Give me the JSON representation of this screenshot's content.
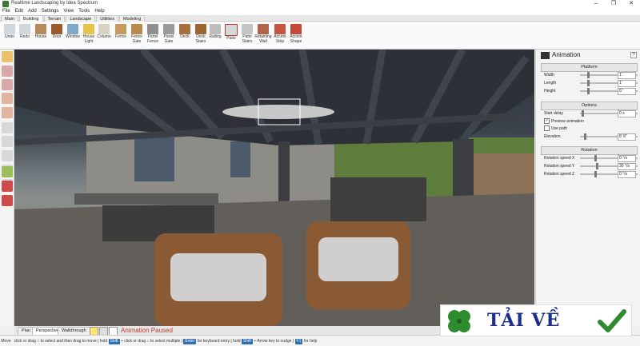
{
  "window": {
    "title": "Realtime Landscaping by Idea Spectrum"
  },
  "menu": [
    "File",
    "Edit",
    "Add",
    "Settings",
    "View",
    "Tools",
    "Help"
  ],
  "ribbon_tabs": [
    "Main",
    "Building",
    "Terrain",
    "Landscape",
    "Utilities",
    "Modeling"
  ],
  "active_ribbon_tab": "Building",
  "tools": [
    {
      "l1": "Undo",
      "l2": ""
    },
    {
      "l1": "Redo",
      "l2": ""
    },
    {
      "l1": "House",
      "l2": ""
    },
    {
      "l1": "Door",
      "l2": ""
    },
    {
      "l1": "Window",
      "l2": ""
    },
    {
      "l1": "House",
      "l2": "Light"
    },
    {
      "l1": "Column",
      "l2": ""
    },
    {
      "l1": "Fence",
      "l2": ""
    },
    {
      "l1": "Fence",
      "l2": "Gate"
    },
    {
      "l1": "Panel",
      "l2": "Fence"
    },
    {
      "l1": "Panel",
      "l2": "Gate"
    },
    {
      "l1": "Deck",
      "l2": ""
    },
    {
      "l1": "Deck",
      "l2": "Stairs"
    },
    {
      "l1": "Railing",
      "l2": ""
    },
    {
      "l1": "Patio",
      "l2": ""
    },
    {
      "l1": "Patio",
      "l2": "Stairs"
    },
    {
      "l1": "Retaining",
      "l2": "Wall"
    },
    {
      "l1": "Accent",
      "l2": "Strip"
    },
    {
      "l1": "Accent",
      "l2": "Shape"
    }
  ],
  "panel": {
    "title": "Animation",
    "help": "?",
    "platform": {
      "header": "Platform",
      "rows": [
        {
          "label": "Width",
          "value": "1'",
          "level": 0.2
        },
        {
          "label": "Length",
          "value": "1'",
          "level": 0.2
        },
        {
          "label": "Height",
          "value": "6\"",
          "level": 0.2
        }
      ]
    },
    "options": {
      "header": "Options",
      "start_delay": {
        "label": "Start delay",
        "value": "0 s",
        "level": 0.05
      },
      "preview": {
        "label": "Preview animation",
        "checked": true
      },
      "use_path": {
        "label": "Use path",
        "checked": false
      },
      "elevation": {
        "label": "Elevation",
        "value": "8' 8\"",
        "level": 0.12
      }
    },
    "rotation": {
      "header": "Rotation",
      "rows": [
        {
          "label": "Rotation speed X",
          "value": "0 °/s",
          "level": 0.4
        },
        {
          "label": "Rotation speed Y",
          "value": "30 °/s",
          "level": 0.45
        },
        {
          "label": "Rotation speed Z",
          "value": "0 °/s",
          "level": 0.4
        }
      ]
    }
  },
  "view_tabs": [
    "Plan",
    "Perspective",
    "Walkthrough"
  ],
  "active_view_tab": "Perspective",
  "animation_status": "Animation Paused",
  "status": {
    "s1": "Move",
    "s2": "click or drag",
    "s3": "to select and then drag to move",
    "s4": "hold",
    "k1": "Shift",
    "s5": "+ click or drag",
    "s6": "to select multiple",
    "k2": "Enter",
    "s7": "for keyboard entry",
    "s8": "hold",
    "k3": "Shift",
    "s9": "+ Arrow key to nudge",
    "k4": "F1",
    "s10": "for help"
  },
  "watermark": {
    "text": "TẢI VỀ"
  },
  "colors": {
    "accent": "#2f6fb0",
    "status_red": "#c0392b",
    "watermark_blue": "#1b2d8f",
    "clover_green": "#2e8b2e"
  },
  "icons": {
    "left_tools": [
      "select-arrow-icon",
      "undo-curve-icon",
      "redo-curve-icon",
      "line-tool-icon",
      "arc-tool-icon",
      "pan-hand-icon",
      "zoom-icon",
      "zoom-extents-icon",
      "orbit-icon",
      "tilt-icon",
      "snap-grid-icon",
      "magnet-icon",
      "magnet-alt-icon"
    ]
  }
}
